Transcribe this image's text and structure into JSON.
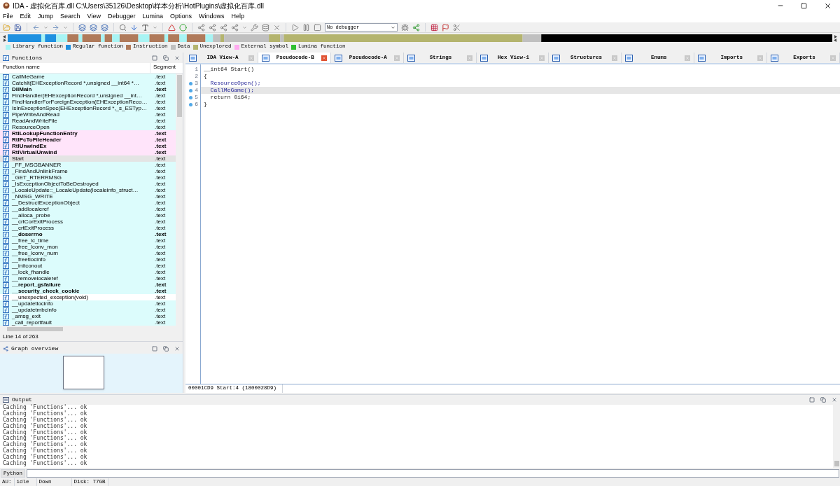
{
  "window": {
    "title": "IDA - 虚拟化百库.dll C:\\Users\\35126\\Desktop\\样本分析\\HotPlugins\\虚拟化百库.dll"
  },
  "menu": [
    "File",
    "Edit",
    "Jump",
    "Search",
    "View",
    "Debugger",
    "Lumina",
    "Options",
    "Windows",
    "Help"
  ],
  "toolbar": {
    "debugger_select": "No debugger"
  },
  "legend": [
    {
      "label": "Library function",
      "color": "#a8f4f4"
    },
    {
      "label": "Regular function",
      "color": "#1e90e0"
    },
    {
      "label": "Instruction",
      "color": "#b07a5a"
    },
    {
      "label": "Data",
      "color": "#c0c0c0"
    },
    {
      "label": "Unexplored",
      "color": "#b4b46e"
    },
    {
      "label": "External symbol",
      "color": "#ffaaf0"
    },
    {
      "label": "Lumina function",
      "color": "#30c030"
    }
  ],
  "functions_panel": {
    "title": "Functions",
    "columns": [
      "Function name",
      "Segment"
    ],
    "rows": [
      {
        "name": "CallMeGame",
        "segment": ".text",
        "kind": "library",
        "bold": false,
        "selected": false
      },
      {
        "name": "CatchIt(EHExceptionRecord *,unsigned __int64 *…",
        "segment": ".text",
        "kind": "library",
        "bold": false,
        "selected": false
      },
      {
        "name": "DllMain",
        "segment": ".text",
        "kind": "library",
        "bold": true,
        "selected": false
      },
      {
        "name": "FindHandler(EHExceptionRecord *,unsigned __int…",
        "segment": ".text",
        "kind": "library",
        "bold": false,
        "selected": false
      },
      {
        "name": "FindHandlerForForeignException(EHExceptionReco…",
        "segment": ".text",
        "kind": "library",
        "bold": false,
        "selected": false
      },
      {
        "name": "IsInExceptionSpec(EHExceptionRecord *,_s_ESTyp…",
        "segment": ".text",
        "kind": "library",
        "bold": false,
        "selected": false
      },
      {
        "name": "PipeWriteAndRead",
        "segment": ".text",
        "kind": "library",
        "bold": false,
        "selected": false
      },
      {
        "name": "ReadAndWriteFile",
        "segment": ".text",
        "kind": "library",
        "bold": false,
        "selected": false
      },
      {
        "name": "ResourceOpen",
        "segment": ".text",
        "kind": "library",
        "bold": false,
        "selected": false
      },
      {
        "name": "RtlLookupFunctionEntry",
        "segment": ".text",
        "kind": "external",
        "bold": true,
        "selected": false
      },
      {
        "name": "RtlPcToFileHeader",
        "segment": ".text",
        "kind": "external",
        "bold": true,
        "selected": false
      },
      {
        "name": "RtlUnwindEx",
        "segment": ".text",
        "kind": "external",
        "bold": true,
        "selected": false
      },
      {
        "name": "RtlVirtualUnwind",
        "segment": ".text",
        "kind": "external",
        "bold": true,
        "selected": false
      },
      {
        "name": "Start",
        "segment": ".text",
        "kind": "library",
        "bold": false,
        "selected": true
      },
      {
        "name": "_FF_MSGBANNER",
        "segment": ".text",
        "kind": "library",
        "bold": false,
        "selected": false
      },
      {
        "name": "_FindAndUnlinkFrame",
        "segment": ".text",
        "kind": "library",
        "bold": false,
        "selected": false
      },
      {
        "name": "_GET_RTERRMSG",
        "segment": ".text",
        "kind": "library",
        "bold": false,
        "selected": false
      },
      {
        "name": "_IsExceptionObjectToBeDestroyed",
        "segment": ".text",
        "kind": "library",
        "bold": false,
        "selected": false
      },
      {
        "name": "_LocaleUpdate::_LocaleUpdate(localeinfo_struct…",
        "segment": ".text",
        "kind": "library",
        "bold": false,
        "selected": false
      },
      {
        "name": "_NMSG_WRITE",
        "segment": ".text",
        "kind": "library",
        "bold": false,
        "selected": false
      },
      {
        "name": "__DestructExceptionObject",
        "segment": ".text",
        "kind": "library",
        "bold": false,
        "selected": false
      },
      {
        "name": "__addlocaleref",
        "segment": ".text",
        "kind": "library",
        "bold": false,
        "selected": false
      },
      {
        "name": "__alloca_probe",
        "segment": ".text",
        "kind": "library",
        "bold": false,
        "selected": false
      },
      {
        "name": "__crtCorExitProcess",
        "segment": ".text",
        "kind": "library",
        "bold": false,
        "selected": false
      },
      {
        "name": "__crtExitProcess",
        "segment": ".text",
        "kind": "library",
        "bold": false,
        "selected": false
      },
      {
        "name": "__doserrno",
        "segment": ".text",
        "kind": "library",
        "bold": true,
        "selected": false
      },
      {
        "name": "__free_lc_time",
        "segment": ".text",
        "kind": "library",
        "bold": false,
        "selected": false
      },
      {
        "name": "__free_lconv_mon",
        "segment": ".text",
        "kind": "library",
        "bold": false,
        "selected": false
      },
      {
        "name": "__free_lconv_num",
        "segment": ".text",
        "kind": "library",
        "bold": false,
        "selected": false
      },
      {
        "name": "__freetlocinfo",
        "segment": ".text",
        "kind": "library",
        "bold": false,
        "selected": false
      },
      {
        "name": "__initconout",
        "segment": ".text",
        "kind": "library",
        "bold": false,
        "selected": false
      },
      {
        "name": "__lock_fhandle",
        "segment": ".text",
        "kind": "library",
        "bold": false,
        "selected": false
      },
      {
        "name": "__removelocaleref",
        "segment": ".text",
        "kind": "library",
        "bold": false,
        "selected": false
      },
      {
        "name": "__report_gsfailure",
        "segment": ".text",
        "kind": "library",
        "bold": true,
        "selected": false
      },
      {
        "name": "__security_check_cookie",
        "segment": ".text",
        "kind": "library",
        "bold": true,
        "selected": false
      },
      {
        "name": "__unexpected_exception(void)",
        "segment": ".text",
        "kind": "regular",
        "bold": false,
        "selected": false
      },
      {
        "name": "__updatetlocinfo",
        "segment": ".text",
        "kind": "library",
        "bold": false,
        "selected": false
      },
      {
        "name": "__updatetmbcinfo",
        "segment": ".text",
        "kind": "library",
        "bold": false,
        "selected": false
      },
      {
        "name": "_amsg_exit",
        "segment": ".text",
        "kind": "library",
        "bold": false,
        "selected": false
      },
      {
        "name": "_call_reportfault",
        "segment": ".text",
        "kind": "library",
        "bold": false,
        "selected": false
      }
    ],
    "line_info": "Line 14 of 263"
  },
  "graph_overview": {
    "title": "Graph overview"
  },
  "tabs": [
    {
      "label": "IDA View-A",
      "selected": false
    },
    {
      "label": "Pseudocode-B",
      "selected": true
    },
    {
      "label": "Pseudocode-A",
      "selected": false
    },
    {
      "label": "Strings",
      "selected": false
    },
    {
      "label": "Hex View-1",
      "selected": false
    },
    {
      "label": "Structures",
      "selected": false
    },
    {
      "label": "Enums",
      "selected": false
    },
    {
      "label": "Imports",
      "selected": false
    },
    {
      "label": "Exports",
      "selected": false
    }
  ],
  "pseudocode": {
    "lines": [
      {
        "number": "1",
        "code": "__int64 Start()",
        "kind": "plain",
        "marker": false,
        "selected": false
      },
      {
        "number": "2",
        "code": "{",
        "kind": "plain",
        "marker": false,
        "selected": false
      },
      {
        "number": "3",
        "code": "  ResourceOpen();",
        "kind": "call",
        "marker": true,
        "selected": false
      },
      {
        "number": "4",
        "code": "  CallMeGame();",
        "kind": "call",
        "marker": true,
        "selected": true
      },
      {
        "number": "5",
        "code": "  return 0i64;",
        "kind": "plain",
        "marker": true,
        "selected": false
      },
      {
        "number": "6",
        "code": "}",
        "kind": "plain",
        "marker": true,
        "selected": false
      }
    ],
    "status": "00001CD9 Start:4 (1800028D9)"
  },
  "output": {
    "title": "Output",
    "lines": [
      "Caching 'Functions'... ok",
      "Caching 'Functions'... ok",
      "Caching 'Functions'... ok",
      "Caching 'Functions'... ok",
      "Caching 'Functions'... ok",
      "Caching 'Functions'... ok",
      "Caching 'Functions'... ok",
      "Caching 'Functions'... ok",
      "Caching 'Functions'... ok",
      "Caching 'Functions'... ok"
    ],
    "interpreter": "Python"
  },
  "status_bar": [
    "AU:",
    "idle",
    "Down",
    "Disk: 77GB"
  ]
}
